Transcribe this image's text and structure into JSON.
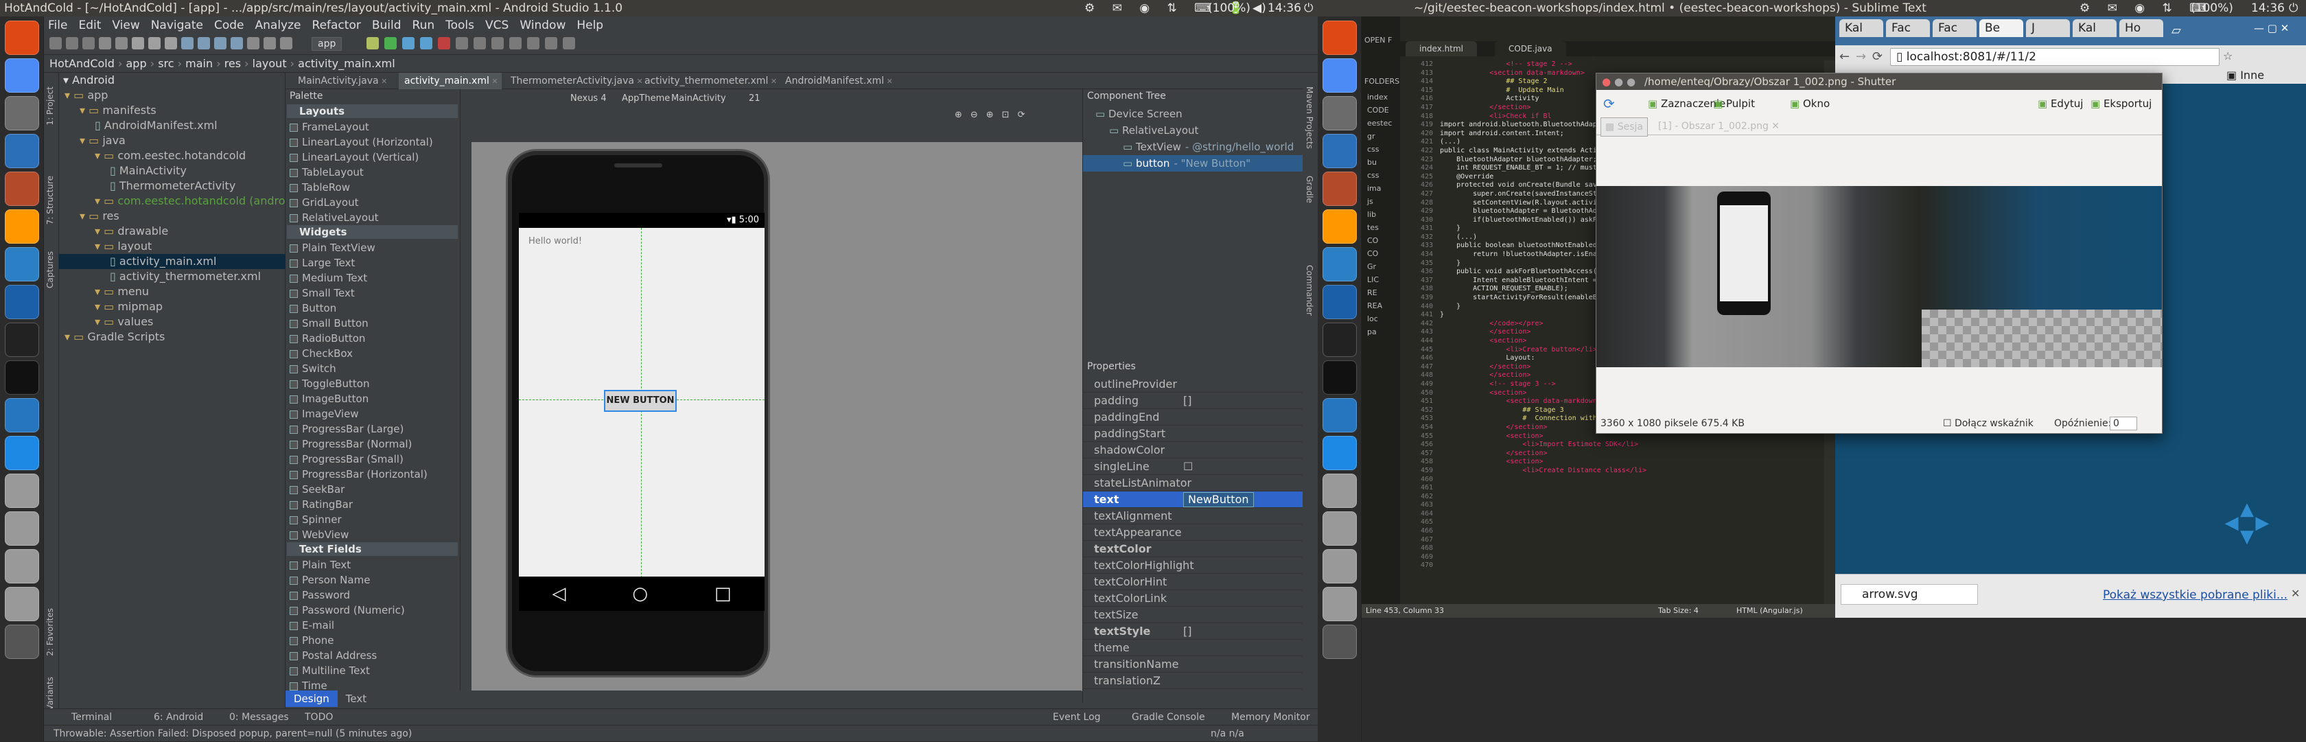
{
  "top_panel_left": {
    "title": "HotAndCold - [~/HotAndCold] - [app] - .../app/src/main/res/layout/activity_main.xml - Android Studio 1.1.0",
    "battery": "(100%)",
    "clock": "14:36"
  },
  "top_panel_right": {
    "title": "~/git/eestec-beacon-workshops/index.html • (eestec-beacon-workshops) - Sublime Text",
    "battery": "(100%)",
    "clock": "14:36"
  },
  "as": {
    "menu": [
      "File",
      "Edit",
      "View",
      "Navigate",
      "Code",
      "Analyze",
      "Refactor",
      "Build",
      "Run",
      "Tools",
      "VCS",
      "Window",
      "Help"
    ],
    "run_config": "app",
    "breadcrumbs": [
      "HotAndCold",
      "app",
      "src",
      "main",
      "res",
      "layout",
      "activity_main.xml"
    ],
    "tabs": [
      "MainActivity.java",
      "activity_main.xml",
      "ThermometerActivity.java",
      "activity_thermometer.xml",
      "AndroidManifest.xml"
    ],
    "project_view": "Android",
    "tree": [
      "app",
      "manifests",
      "AndroidManifest.xml",
      "java",
      "com.eestec.hotandcold",
      "MainActivity",
      "ThermometerActivity",
      "com.eestec.hotandcold (androidT",
      "res",
      "drawable",
      "layout",
      "activity_main.xml",
      "activity_thermometer.xml",
      "menu",
      "mipmap",
      "values",
      "Gradle Scripts"
    ],
    "side_tools": [
      "1: Project",
      "7: Structure",
      "Captures",
      "2: Favorites",
      "Build Variants"
    ],
    "palette_title": "Palette",
    "palette": [
      {
        "h": "Layouts"
      },
      {
        "i": "FrameLayout"
      },
      {
        "i": "LinearLayout (Horizontal)"
      },
      {
        "i": "LinearLayout (Vertical)"
      },
      {
        "i": "TableLayout"
      },
      {
        "i": "TableRow"
      },
      {
        "i": "GridLayout"
      },
      {
        "i": "RelativeLayout"
      },
      {
        "h": "Widgets"
      },
      {
        "i": "Plain TextView"
      },
      {
        "i": "Large Text"
      },
      {
        "i": "Medium Text"
      },
      {
        "i": "Small Text"
      },
      {
        "i": "Button"
      },
      {
        "i": "Small Button"
      },
      {
        "i": "RadioButton"
      },
      {
        "i": "CheckBox"
      },
      {
        "i": "Switch"
      },
      {
        "i": "ToggleButton"
      },
      {
        "i": "ImageButton"
      },
      {
        "i": "ImageView"
      },
      {
        "i": "ProgressBar (Large)"
      },
      {
        "i": "ProgressBar (Normal)"
      },
      {
        "i": "ProgressBar (Small)"
      },
      {
        "i": "ProgressBar (Horizontal)"
      },
      {
        "i": "SeekBar"
      },
      {
        "i": "RatingBar"
      },
      {
        "i": "Spinner"
      },
      {
        "i": "WebView"
      },
      {
        "h": "Text Fields"
      },
      {
        "i": "Plain Text"
      },
      {
        "i": "Person Name"
      },
      {
        "i": "Password"
      },
      {
        "i": "Password (Numeric)"
      },
      {
        "i": "E-mail"
      },
      {
        "i": "Phone"
      },
      {
        "i": "Postal Address"
      },
      {
        "i": "Multiline Text"
      },
      {
        "i": "Time"
      }
    ],
    "design_toolbar": {
      "device": "Nexus 4",
      "theme": "AppTheme",
      "activity": "MainActivity",
      "api": "21"
    },
    "phone": {
      "time": "5:00",
      "hello": "Hello world!",
      "button": "NEW BUTTON"
    },
    "component_tree_title": "Component Tree",
    "component_tree": [
      {
        "label": "Device Screen",
        "extra": ""
      },
      {
        "label": "RelativeLayout",
        "extra": ""
      },
      {
        "label": "TextView",
        "extra": "- @string/hello_world"
      },
      {
        "label": "button",
        "extra": "- \"New Button\""
      }
    ],
    "properties_title": "Properties",
    "properties": [
      {
        "name": "outlineProvider",
        "value": "",
        "bold": false
      },
      {
        "name": "padding",
        "value": "[]",
        "bold": false
      },
      {
        "name": "paddingEnd",
        "value": "",
        "bold": false
      },
      {
        "name": "paddingStart",
        "value": "",
        "bold": false
      },
      {
        "name": "shadowColor",
        "value": "",
        "bold": false
      },
      {
        "name": "singleLine",
        "value": "☐",
        "bold": false
      },
      {
        "name": "stateListAnimator",
        "value": "",
        "bold": false
      },
      {
        "name": "text",
        "value": "NewButton",
        "bold": true,
        "selected": true
      },
      {
        "name": "textAlignment",
        "value": "",
        "bold": false
      },
      {
        "name": "textAppearance",
        "value": "",
        "bold": false
      },
      {
        "name": "textColor",
        "value": "",
        "bold": true
      },
      {
        "name": "textColorHighlight",
        "value": "",
        "bold": false
      },
      {
        "name": "textColorHint",
        "value": "",
        "bold": false
      },
      {
        "name": "textColorLink",
        "value": "",
        "bold": false
      },
      {
        "name": "textSize",
        "value": "",
        "bold": false
      },
      {
        "name": "textStyle",
        "value": "[]",
        "bold": true
      },
      {
        "name": "theme",
        "value": "",
        "bold": false
      },
      {
        "name": "transitionName",
        "value": "",
        "bold": false
      },
      {
        "name": "translationZ",
        "value": "",
        "bold": false
      }
    ],
    "right_tools": [
      "Maven Projects",
      "Gradle",
      "Commander"
    ],
    "editor_tabs": [
      "Design",
      "Text"
    ],
    "bottom_tools": [
      "Terminal",
      "6: Android",
      "0: Messages",
      "TODO"
    ],
    "bottom_tools_right": [
      "Event Log",
      "Gradle Console",
      "Memory Monitor"
    ],
    "status": "Throwable: Assertion Failed: Disposed popup, parent=null (5 minutes ago)",
    "status_right": "n/a    n/a"
  },
  "sublime": {
    "open_files_label": "OPEN F",
    "folders_label": "FOLDERS",
    "sidebar": [
      "index",
      "CODE",
      "eestec",
      "gr",
      "css",
      "bu",
      "css",
      "ima",
      "js",
      "lib",
      "tes",
      "CO",
      "CO",
      "Gr",
      "LIC",
      "RE",
      "REA",
      "loc",
      "pa"
    ],
    "tabs": [
      "index.html",
      "CODE.java"
    ],
    "line_start": 412,
    "lines": [
      "                <!-- stage 2 -->",
      "            <section data-markdown>",
      "                ## Stage 2",
      "                #  Update Main",
      "                Activity",
      "            </section>",
      "            <li>Check if Bl",
      "",
      "import android.bluetooth.BluetoothAdapt",
      "import android.content.Intent;",
      "",
      "(...)",
      "",
      "public class MainActivity extends Activ",
      "",
      "    BluetoothAdapter bluetoothAdapter;",
      "",
      "    int REQUEST_ENABLE_BT = 1; // must",
      "",
      "    @Override",
      "    protected void onCreate(Bundle save",
      "        super.onCreate(savedInstanceSt",
      "        setContentView(R.layout.activi",
      "        bluetoothAdapter = BluetoothAda",
      "        if(bluetoothNotEnabled()) askFo",
      "    }",
      "",
      "    (...)",
      "",
      "    public boolean bluetoothNotEnabled(",
      "        return !bluetoothAdapter.isEnab",
      "    }",
      "",
      "    public void askForBluetoothAccess(){",
      "        Intent enableBluetoothIntent =",
      "        ACTION_REQUEST_ENABLE);",
      "        startActivityForResult(enableBl",
      "    }",
      "}",
      "",
      "            </code></pre>",
      "            </section>",
      "            <section>",
      "                <li>Create button</li>",
      "                Layout:",
      "            </section>",
      "            </section>",
      "",
      "            <!-- stage 3 -->",
      "            <section>",
      "                <section data-markdown>",
      "                    ## Stage 3",
      "                    #  Connection with Estimote SDK",
      "                </section>",
      "                <section>",
      "                    <li>Import Estimote SDK</li>",
      "                </section>",
      "                <section>",
      "                    <li>Create Distance class</li>"
    ],
    "status_left": "Line 453, Column 33",
    "tab_size": "Tab Size: 4",
    "syntax": "HTML (Angular.js)"
  },
  "chrome": {
    "tabs": [
      "Kal",
      "Fac",
      "Fac",
      "Be",
      "J",
      "Kal",
      "Ho"
    ],
    "url": "localhost:8081/#/11/2",
    "bookmarks": "Inne zakładki",
    "download_file": "arrow.svg",
    "download_all": "Pokaż wszystkie pobrane pliki..."
  },
  "shutter": {
    "title": "/home/enteq/Obrazy/Obszar 1_002.png - Shutter",
    "toolbar": [
      "Zaznaczenie",
      "Pulpit",
      "Okno",
      "Edytuj",
      "Eksportuj"
    ],
    "session": "Sesja",
    "tab": "[1] - Obszar 1_002.png",
    "info": "3360 x 1080 piksele  675.4 KB",
    "pointer": "Dołącz wskaźnik",
    "delay_label": "Opóźnienie:",
    "delay_value": "0"
  },
  "launcher_icons": [
    "ubuntu-icon",
    "chromium-icon",
    "files-icon",
    "writer-icon",
    "settings-icon",
    "sublime-icon",
    "thunderbird-icon",
    "browser-icon",
    "terminal-icon",
    "inkscape-icon",
    "android-studio-icon",
    "blue-app-icon",
    "drive-icon",
    "drive-icon",
    "drive-icon",
    "drive-icon",
    "trash-icon"
  ],
  "colors": {
    "accent_blue": "#2f65ca",
    "selection": "#2d5b8a",
    "android_blue": "#2675bf"
  }
}
